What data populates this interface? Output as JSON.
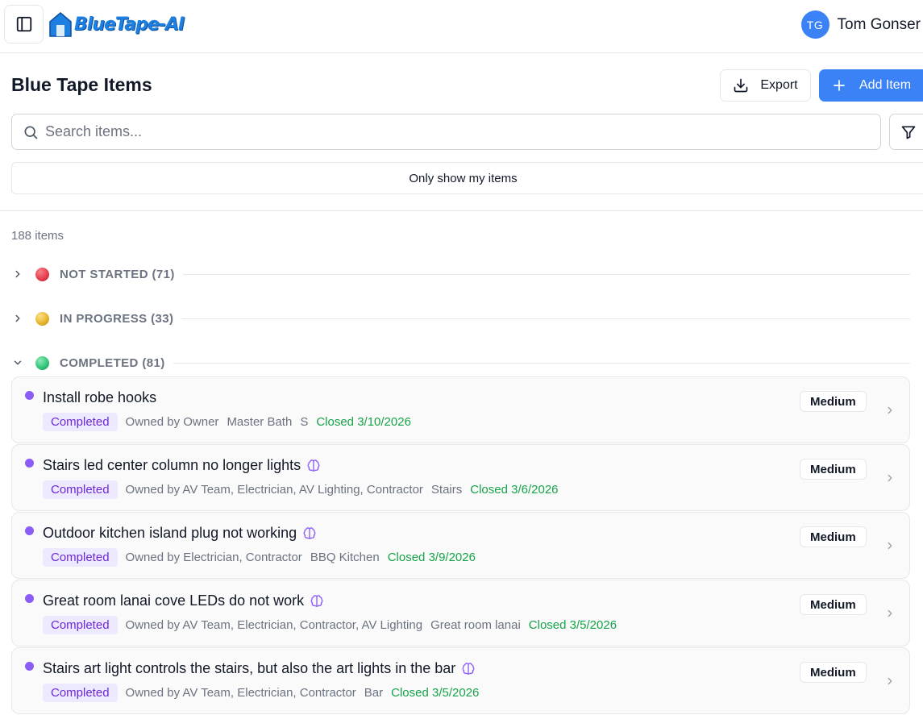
{
  "app": {
    "logo_text": "BlueTape-AI"
  },
  "user": {
    "initials": "TG",
    "name": "Tom Gonser"
  },
  "header": {
    "title": "Blue Tape Items",
    "export_label": "Export",
    "add_label": "Add Item"
  },
  "search": {
    "placeholder": "Search items..."
  },
  "filter": {
    "only_mine_label": "Only show my items"
  },
  "count_text": "188 items",
  "groups": [
    {
      "label": "NOT STARTED (71)",
      "color": "#e5404f",
      "expanded": false
    },
    {
      "label": "IN PROGRESS (33)",
      "color": "#e8b730",
      "expanded": false
    },
    {
      "label": "COMPLETED (81)",
      "color": "#34c77b",
      "expanded": true
    }
  ],
  "items": [
    {
      "title": "Install robe hooks",
      "ai": false,
      "status": "Completed",
      "owner": "Owned by Owner",
      "location": "Master Bath",
      "extra": "S",
      "closed": "Closed 3/10/2026",
      "priority": "Medium"
    },
    {
      "title": "Stairs led center column no longer lights",
      "ai": true,
      "status": "Completed",
      "owner": "Owned by AV Team, Electrician, AV Lighting, Contractor",
      "location": "Stairs",
      "extra": "",
      "closed": "Closed 3/6/2026",
      "priority": "Medium"
    },
    {
      "title": "Outdoor kitchen island plug not working",
      "ai": true,
      "status": "Completed",
      "owner": "Owned by Electrician, Contractor",
      "location": "BBQ Kitchen",
      "extra": "",
      "closed": "Closed 3/9/2026",
      "priority": "Medium"
    },
    {
      "title": "Great room lanai cove LEDs do not work",
      "ai": true,
      "status": "Completed",
      "owner": "Owned by AV Team, Electrician, Contractor, AV Lighting",
      "location": "Great room lanai",
      "extra": "",
      "closed": "Closed 3/5/2026",
      "priority": "Medium"
    },
    {
      "title": "Stairs art light controls the stairs, but also the art lights in the bar",
      "ai": true,
      "status": "Completed",
      "owner": "Owned by AV Team, Electrician, Contractor",
      "location": "Bar",
      "extra": "",
      "closed": "Closed 3/5/2026",
      "priority": "Medium"
    }
  ],
  "colors": {
    "accent": "#3b82f6",
    "status_dot": "#8b5cf6",
    "closed_green": "#16a34a"
  }
}
